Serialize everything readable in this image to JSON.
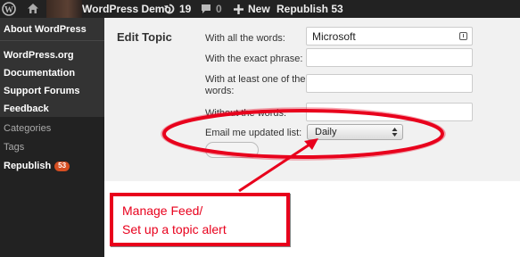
{
  "admin_bar": {
    "site_name": "WordPress Demo",
    "updates_count": "19",
    "comments_count": "0",
    "new_label": "New",
    "republish_label": "Republish 53"
  },
  "sidebar": {
    "header_item": "About WordPress",
    "links": [
      "WordPress.org",
      "Documentation",
      "Support Forums",
      "Feedback"
    ],
    "sub_items": [
      "Categories",
      "Tags"
    ],
    "active_item": "Republish",
    "active_badge": "53"
  },
  "main": {
    "title": "Edit Topic",
    "fields": {
      "all_words_label": "With all the words:",
      "all_words_value": "Microsoft",
      "exact_phrase_label": "With the exact phrase:",
      "at_least_one_label_line1": "With at least one of the",
      "at_least_one_label_line2": "words:",
      "without_words_label": "Without the words:",
      "email_label": "Email me updated list:",
      "email_selected": "Daily"
    }
  },
  "annotation": {
    "line1": "Manage Feed/",
    "line2": "Set up a topic alert",
    "color": "#e8001c"
  }
}
